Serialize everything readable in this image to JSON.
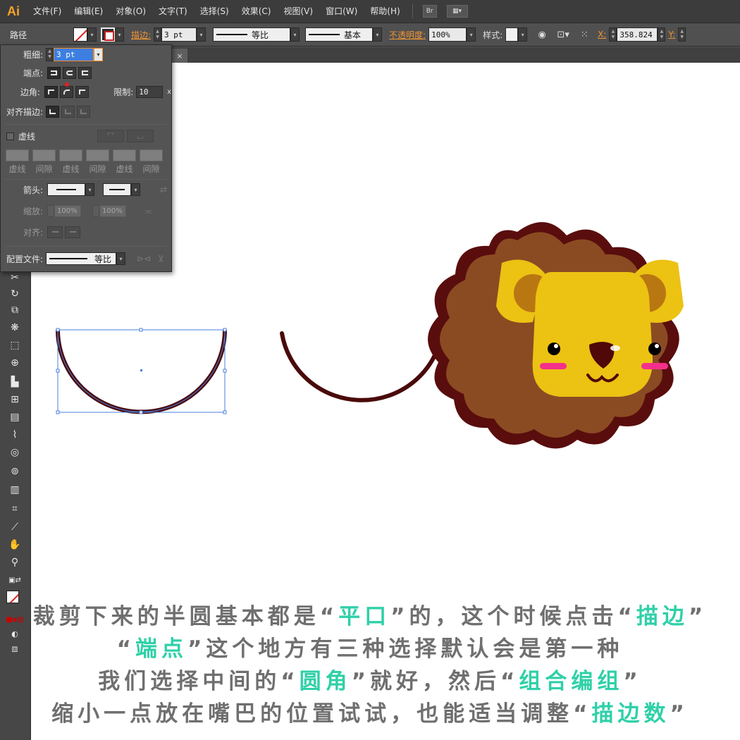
{
  "app": {
    "logo": "Ai",
    "menus": [
      "文件(F)",
      "编辑(E)",
      "对象(O)",
      "文字(T)",
      "选择(S)",
      "效果(C)",
      "视图(V)",
      "窗口(W)",
      "帮助(H)"
    ],
    "bridge_label": "Br"
  },
  "controlbar": {
    "object_type": "路径",
    "stroke_label": "描边:",
    "stroke_weight": "3 pt",
    "profile_label": "等比",
    "brush_label": "基本",
    "opacity_label": "不透明度:",
    "opacity_value": "100%",
    "style_label": "样式:",
    "x_label": "X:",
    "x_value": "358.824",
    "y_label": "Y:"
  },
  "document_tab": {
    "close": "×"
  },
  "stroke_panel": {
    "weight_label": "粗细:",
    "weight_value": "3 pt",
    "cap_label": "端点:",
    "corner_label": "边角:",
    "limit_label": "限制:",
    "limit_value": "10",
    "limit_unit": "x",
    "align_label": "对齐描边:",
    "dashed_label": "虚线",
    "dash_labels": [
      "虚线",
      "间隙",
      "虚线",
      "间隙",
      "虚线",
      "间隙"
    ],
    "arrow_label": "箭头:",
    "scale_label": "缩放:",
    "scale_start": "100%",
    "scale_end": "100%",
    "arrow_align_label": "对齐:",
    "profile_label": "配置文件:",
    "profile_value": "等比"
  },
  "colors": {
    "stroke_dark": "#4a0a0a",
    "selection": "#4a7fe0",
    "mane_outline": "#5a0d0d",
    "mane_fill": "#8a4b22",
    "face_yellow": "#ecc213",
    "ear_inner": "#b97712",
    "blush": "#f4308c",
    "nose": "#500808",
    "caption_gray": "#6f6f6f",
    "caption_highlight": "#2fd0a8"
  },
  "caption": {
    "line1": [
      "裁剪下来的半圆基本都是“",
      "平口",
      "”的，这个时候点击“",
      "描边",
      "”"
    ],
    "line2": [
      "“",
      "端点",
      "”这个地方有三种选择默认会是第一种"
    ],
    "line3": [
      "我们选择中间的“",
      "圆角",
      "”就好，然后“",
      "组合编组",
      "”"
    ],
    "line4": [
      "缩小一点放在嘴巴的位置试试，也能适当调整“",
      "描边数",
      "”"
    ]
  }
}
